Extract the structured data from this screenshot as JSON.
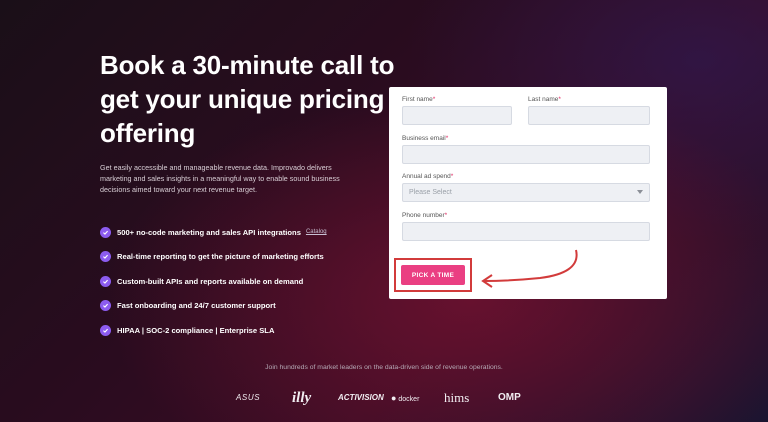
{
  "hero": {
    "headline": "Book a 30-minute call to get your unique pricing offering",
    "subtext": "Get easily accessible and manageable revenue data. Improvado delivers marketing and sales insights in a meaningful way to enable sound business decisions aimed toward your next revenue target.",
    "features": [
      {
        "text": "500+ no-code marketing and sales API integrations",
        "link": "Catalog"
      },
      {
        "text": "Real-time reporting to get the picture of marketing efforts"
      },
      {
        "text": "Custom-built APIs and reports available on demand"
      },
      {
        "text": "Fast onboarding and 24/7 customer support"
      },
      {
        "text": "HIPAA | SOC-2 compliance | Enterprise SLA"
      }
    ]
  },
  "form": {
    "first_name_label": "First name",
    "last_name_label": "Last name",
    "business_email_label": "Business email",
    "ad_spend_label": "Annual ad spend",
    "ad_spend_placeholder": "Please Select",
    "phone_label": "Phone number",
    "required_mark": "*",
    "submit_label": "PICK A TIME"
  },
  "footer": {
    "join_text": "Join hundreds of market leaders on the data-driven side of revenue operations.",
    "logos": [
      "ASUS",
      "illy",
      "ACTIVISION",
      "docker",
      "hims",
      "OMP"
    ]
  },
  "colors": {
    "accent": "#ea3f82",
    "check": "#8c5cf0",
    "annotation": "#d23b3b"
  }
}
